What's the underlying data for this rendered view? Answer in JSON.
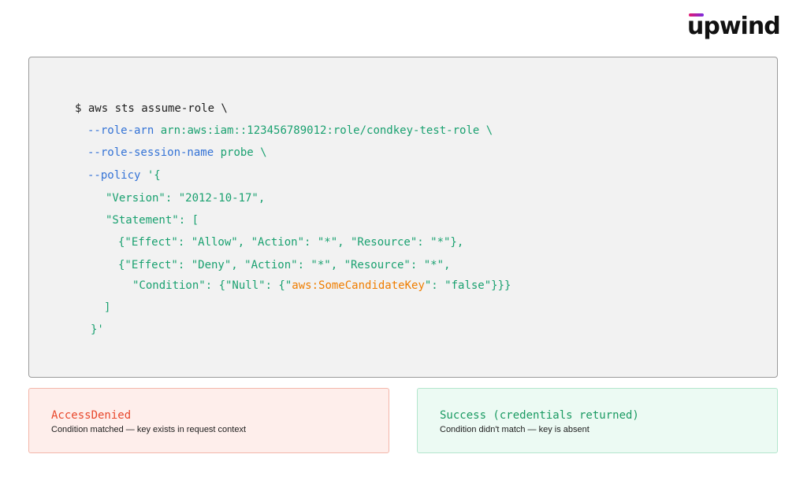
{
  "brand": {
    "logo_text": "upwind",
    "accent_gradient": [
      "#e3186f",
      "#7b2be0"
    ]
  },
  "code": {
    "lines": [
      [
        {
          "t": "$ aws sts assume-role \\",
          "c": "dark"
        }
      ],
      [
        {
          "t": "--role-arn",
          "c": "blue"
        },
        {
          "t": " arn:aws:iam::123456789012:role/condkey-test-role \\",
          "c": "green"
        }
      ],
      [
        {
          "t": "--role-session-name",
          "c": "blue"
        },
        {
          "t": " probe \\",
          "c": "green"
        }
      ],
      [
        {
          "t": "--policy",
          "c": "blue"
        },
        {
          "t": " '{",
          "c": "green"
        }
      ],
      [
        {
          "t": "\"Version\": \"2012-10-17\",",
          "c": "green"
        }
      ],
      [
        {
          "t": "\"Statement\": [",
          "c": "green"
        }
      ],
      [
        {
          "t": "{\"Effect\": \"Allow\", \"Action\": \"*\", \"Resource\": \"*\"},",
          "c": "green"
        }
      ],
      [
        {
          "t": "{\"Effect\": \"Deny\", \"Action\": \"*\", \"Resource\": \"*\",",
          "c": "green"
        }
      ],
      [
        {
          "t": "\"Condition\": {\"Null\": {\"",
          "c": "green"
        },
        {
          "t": "aws:SomeCandidateKey",
          "c": "orange"
        },
        {
          "t": "\": \"false\"}}}",
          "c": "green"
        }
      ],
      [
        {
          "t": "]",
          "c": "green"
        }
      ],
      [
        {
          "t": "}'",
          "c": "green"
        }
      ]
    ],
    "colors": {
      "dark": "#1d1d1d",
      "blue": "#3473d6",
      "green": "#1aa170",
      "orange": "#ef7d00"
    }
  },
  "results": {
    "denied": {
      "title": "AccessDenied",
      "description": "Condition matched — key exists in request context",
      "accent": "#e8472b"
    },
    "success": {
      "title": "Success (credentials returned)",
      "description": "Condition didn't match — key is absent",
      "accent": "#1a9a62"
    }
  }
}
